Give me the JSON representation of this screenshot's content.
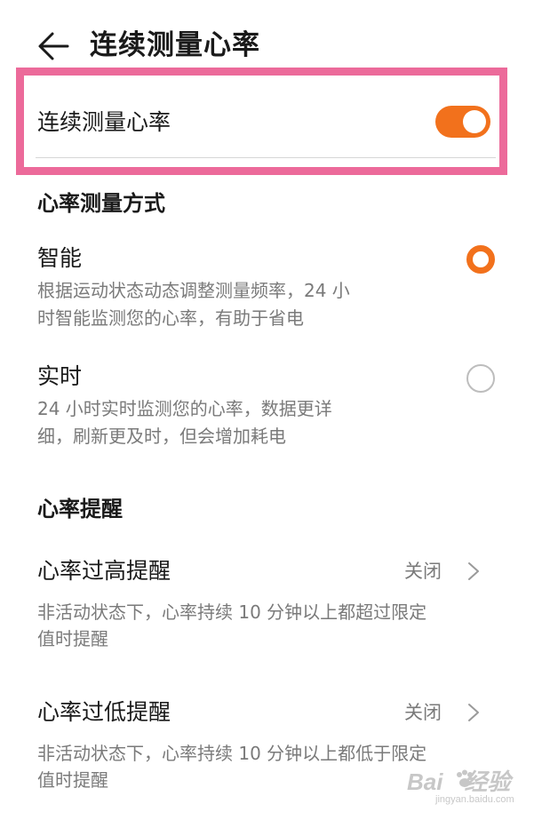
{
  "header": {
    "back_icon": "arrow-left-icon",
    "title": "连续测量心率"
  },
  "continuous_toggle": {
    "label": "连续测量心率",
    "enabled": true,
    "accent_color": "#f2711c",
    "highlight_color": "#ec6a9a"
  },
  "measure_mode": {
    "heading": "心率测量方式",
    "options": [
      {
        "title": "智能",
        "description_lines": [
          "根据运动状态动态调整测量频率，24 小",
          "时智能监测您的心率，有助于省电"
        ],
        "selected": true
      },
      {
        "title": "实时",
        "description_lines": [
          "24 小时实时监测您的心率，数据更详",
          "细，刷新更及时，但会增加耗电"
        ],
        "selected": false
      }
    ]
  },
  "reminders": {
    "heading": "心率提醒",
    "items": [
      {
        "title": "心率过高提醒",
        "value": "关闭",
        "chevron_icon": "chevron-right-icon",
        "description_lines": [
          "非活动状态下，心率持续 10 分钟以上都超过限定",
          "值时提醒"
        ]
      },
      {
        "title": "心率过低提醒",
        "value": "关闭",
        "chevron_icon": "chevron-right-icon",
        "description_lines": [
          "非活动状态下，心率持续 10 分钟以上都低于限定",
          "值时提醒"
        ]
      }
    ]
  },
  "watermark": {
    "logo_text": "Bai",
    "logo_text_2": "经验",
    "sub_text": "jingyan.baidu.com"
  }
}
